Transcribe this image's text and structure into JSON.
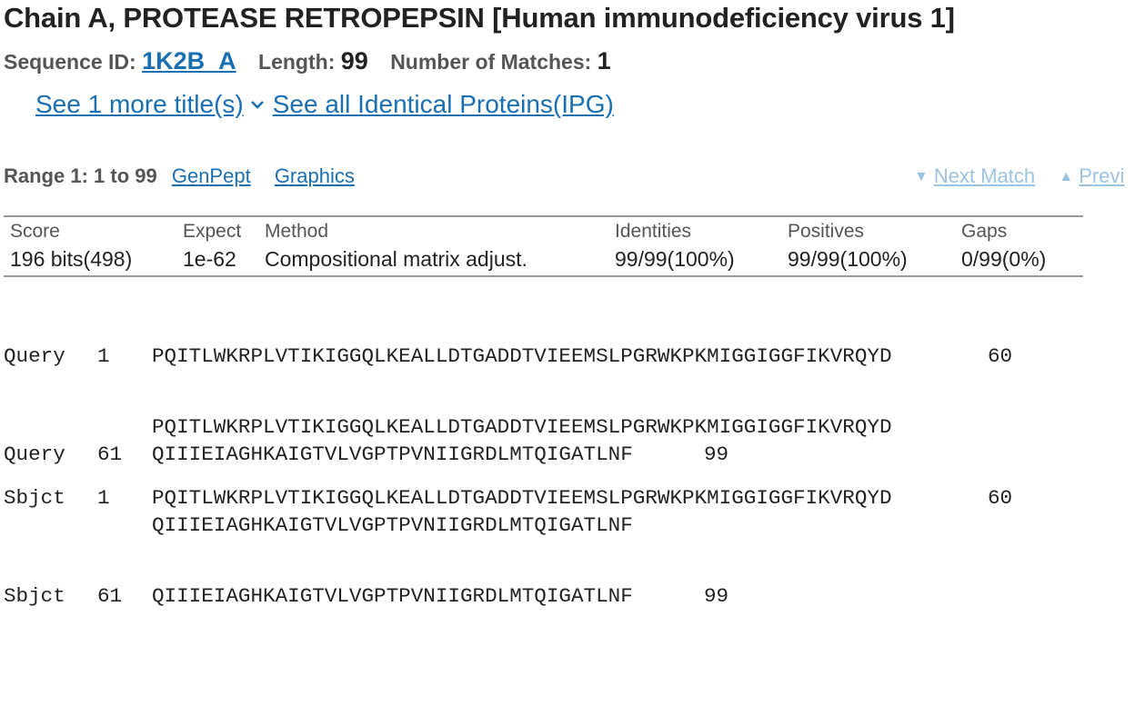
{
  "title": "Chain A, PROTEASE RETROPEPSIN [Human immunodeficiency virus 1]",
  "meta": {
    "seq_id_label": "Sequence ID:",
    "seq_id": "1K2B_A",
    "length_label": "Length:",
    "length": "99",
    "matches_label": "Number of Matches:",
    "matches": "1"
  },
  "links": {
    "more_titles": "See 1 more title(s)",
    "identical_proteins": "See all Identical Proteins(IPG)"
  },
  "range": {
    "label": "Range 1: 1 to 99",
    "genpept": "GenPept",
    "graphics": "Graphics",
    "next_match": "Next Match",
    "previous_match": "Previ"
  },
  "stats": {
    "headers": [
      "Score",
      "Expect",
      "Method",
      "Identities",
      "Positives",
      "Gaps"
    ],
    "values": [
      "196 bits(498)",
      "1e-62",
      "Compositional matrix adjust.",
      "99/99(100%)",
      "99/99(100%)",
      "0/99(0%)"
    ]
  },
  "alignment": [
    {
      "query": {
        "label": "Query",
        "start": "1",
        "seq": "PQITLWKRPLVTIKIGGQLKEALLDTGADDTVIEEMSLPGRWKPKMIGGIGGFIKVRQYD",
        "end": "60"
      },
      "midline": "PQITLWKRPLVTIKIGGQLKEALLDTGADDTVIEEMSLPGRWKPKMIGGIGGFIKVRQYD",
      "sbjct": {
        "label": "Sbjct",
        "start": "1",
        "seq": "PQITLWKRPLVTIKIGGQLKEALLDTGADDTVIEEMSLPGRWKPKMIGGIGGFIKVRQYD",
        "end": "60"
      }
    },
    {
      "query": {
        "label": "Query",
        "start": "61",
        "seq": "QIIIEIAGHKAIGTVLVGPTPVNIIGRDLMTQIGATLNF",
        "end": "99"
      },
      "midline": "QIIIEIAGHKAIGTVLVGPTPVNIIGRDLMTQIGATLNF",
      "sbjct": {
        "label": "Sbjct",
        "start": "61",
        "seq": "QIIIEIAGHKAIGTVLVGPTPVNIIGRDLMTQIGATLNF",
        "end": "99"
      }
    }
  ],
  "colors": {
    "link": "#1a6fb3",
    "link_disabled": "#9cc3e0",
    "rule": "#9a9a9a"
  },
  "icons": {
    "more_titles": "chevron-down-icon",
    "next": "triangle-down-icon",
    "previous": "triangle-up-icon"
  }
}
